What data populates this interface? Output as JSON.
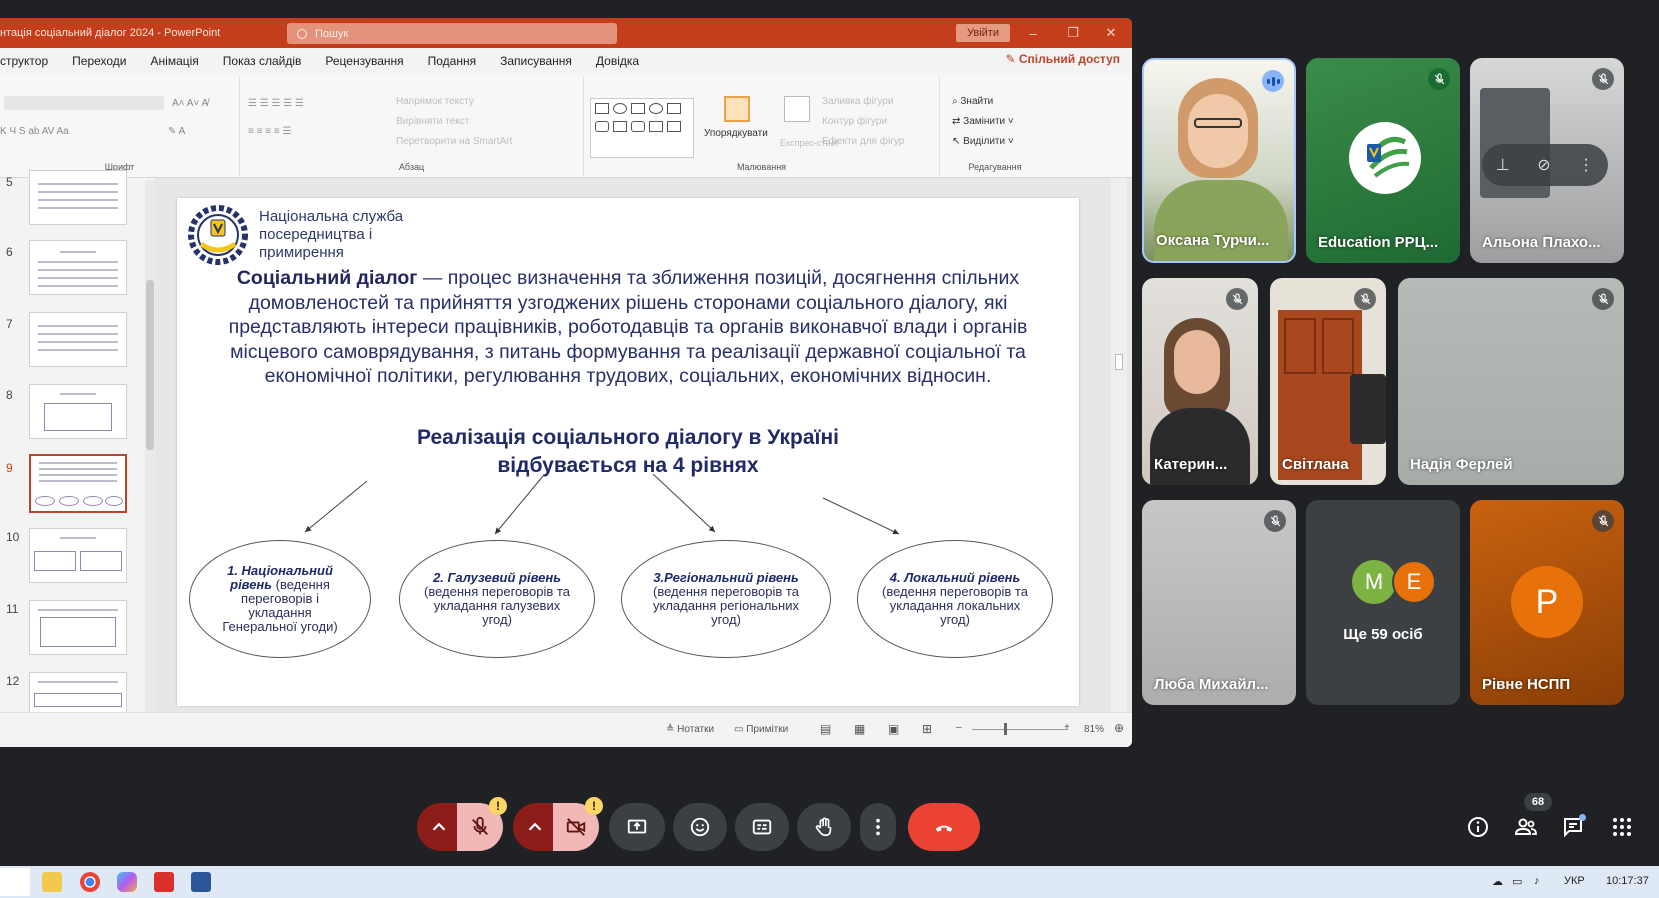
{
  "ppt": {
    "doc_title": "нтація соціальний діалог 2024  -  PowerPoint",
    "search_placeholder": "Пошук",
    "signin_label": "Увійти",
    "menu": [
      "структор",
      "Переходи",
      "Анімація",
      "Показ слайдів",
      "Рецензування",
      "Подання",
      "Записування",
      "Довідка"
    ],
    "share_label": "Спільний доступ",
    "ribbon": {
      "font_group": "Шрифт",
      "paragraph_group": "Абзац",
      "drawing_group": "Малювання",
      "editing_group": "Редагування",
      "arrange_label": "Упорядкувати",
      "quick_styles": "Експрес-стилі",
      "find_label": "Знайти",
      "replace_label": "Замінити",
      "select_label": "Виділити",
      "text_direction": "Напрямок тексту",
      "align_text": "Вирівняти текст",
      "smartart": "Перетворити на SmartArt",
      "shape_fill": "Заливка фігури",
      "shape_outline": "Контур фігури",
      "shape_effects": "Ефекти для фігур"
    },
    "thumb_numbers": [
      "5",
      "6",
      "7",
      "8",
      "9",
      "10",
      "11",
      "12"
    ],
    "active_slide": "9",
    "status": {
      "notes": "Нотатки",
      "comments": "Примітки",
      "zoom": "81%"
    }
  },
  "slide": {
    "org_name": "Національна служба\nпосередництва і\nпримирення",
    "para_bold": "Соціальний діалог",
    "para_rest": " — процес визначення та зближення позицій, досягнення спільних домовленостей та прийняття узгоджених рішень сторонами соціального діалогу, які представляють інтереси працівників, роботодавців та органів виконавчої влади і органів місцевого самоврядування, з питань формування та реалізації державної соціальної та економічної політики, регулювання трудових, соціальних, економічних відносин.",
    "subhead_1": "Реалізація соціального діалогу в Україні",
    "subhead_2": "відбувається на 4 рівнях",
    "levels": [
      {
        "title": "1. Національний рівень",
        "rest": " (ведення переговорів і укладання Генеральної угоди)"
      },
      {
        "title": "2. Галузевий рівень",
        "rest": " (ведення переговорів та укладання галузевих угод)"
      },
      {
        "title": "3.Регіональний рівень",
        "rest": " (ведення переговорів та укладання регіональних угод)"
      },
      {
        "title": "4. Локальний рівень",
        "rest": " (ведення переговорів та укладання локальних угод)"
      }
    ]
  },
  "participants": [
    {
      "name": "Оксана Турчи...",
      "state": "speaking"
    },
    {
      "name": "Education РРЦ...",
      "state": "muted"
    },
    {
      "name": "Альона Плахо...",
      "state": "muted"
    },
    {
      "name": "Катерин...",
      "state": "muted"
    },
    {
      "name": "Світлана",
      "state": "muted"
    },
    {
      "name": "Надія Ферлей",
      "state": "muted"
    },
    {
      "name": "Люба Михайл...",
      "state": "muted"
    },
    {
      "name": "Ще 59 осіб",
      "state": "group",
      "initials": [
        "M",
        "E"
      ]
    },
    {
      "name": "Рівне НСПП",
      "state": "muted",
      "initial": "P"
    }
  ],
  "colors": {
    "ppt_accent": "#c43e1c",
    "end_call": "#ea4335",
    "warn": "#fdd663",
    "avatar_orange": "#e8710a",
    "avatar_green": "#7cb342"
  },
  "meet": {
    "participant_count": "68"
  },
  "taskbar": {
    "lang": "УКР",
    "time": "10:17:37"
  }
}
